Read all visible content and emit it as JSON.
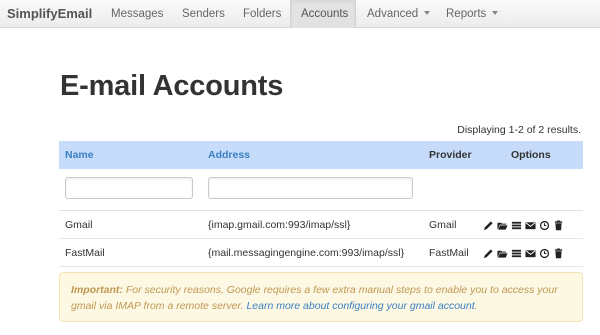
{
  "navbar": {
    "brand": "SimplifyEmail",
    "items": [
      {
        "label": "Messages"
      },
      {
        "label": "Senders"
      },
      {
        "label": "Folders"
      },
      {
        "label": "Accounts"
      },
      {
        "label": "Advanced"
      },
      {
        "label": "Reports"
      }
    ],
    "active": "Accounts"
  },
  "page": {
    "title": "E-mail Accounts",
    "summary": "Displaying 1-2 of 2 results."
  },
  "table": {
    "headers": {
      "name": "Name",
      "address": "Address",
      "provider": "Provider",
      "options": "Options"
    },
    "filters": {
      "name_value": "",
      "address_value": ""
    },
    "rows": [
      {
        "name": "Gmail",
        "address": "{imap.gmail.com:993/imap/ssl}",
        "provider": "Gmail"
      },
      {
        "name": "FastMail",
        "address": "{mail.messagingengine.com:993/imap/ssl}",
        "provider": "FastMail"
      }
    ],
    "option_icons": [
      "pencil-icon",
      "folder-open-icon",
      "list-icon",
      "envelope-icon",
      "clock-icon",
      "trash-icon"
    ]
  },
  "alert": {
    "strong": "Important:",
    "body": " For security reasons, Google requires a few extra manual steps to enable you to access your gmail via IMAP from a remote server. ",
    "link": "Learn more about configuring your gmail account",
    "end": "."
  },
  "colors": {
    "header_bg": "#c6dcfa",
    "link": "#3a7fc2",
    "alert_bg": "#fcf8e3",
    "alert_text": "#c09853"
  }
}
